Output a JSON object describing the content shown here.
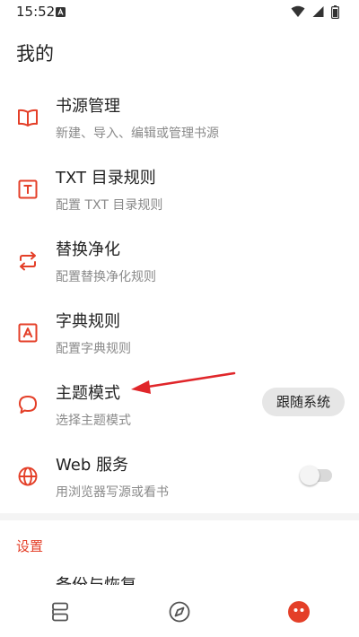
{
  "status_bar": {
    "time": "15:52",
    "icons": [
      "notification-icon",
      "wifi-icon",
      "signal-icon",
      "battery-icon"
    ]
  },
  "page_title": "我的",
  "menu": [
    {
      "title": "书源管理",
      "subtitle": "新建、导入、编辑或管理书源",
      "icon": "book-open-icon"
    },
    {
      "title": "TXT 目录规则",
      "subtitle": "配置 TXT 目录规则",
      "icon": "text-box-icon"
    },
    {
      "title": "替换净化",
      "subtitle": "配置替换净化规则",
      "icon": "swap-arrows-icon"
    },
    {
      "title": "字典规则",
      "subtitle": "配置字典规则",
      "icon": "letter-a-box-icon"
    },
    {
      "title": "主题模式",
      "subtitle": "选择主题模式",
      "icon": "speech-bubble-icon",
      "value": "跟随系统"
    },
    {
      "title": "Web 服务",
      "subtitle": "用浏览器写源或看书",
      "icon": "globe-icon",
      "toggle_on": false
    }
  ],
  "settings_section": {
    "title": "设置",
    "first_item": "备份与恢复"
  },
  "bottom_nav": {
    "items": [
      "bookshelf-icon",
      "compass-icon",
      "my-profile-icon"
    ],
    "active_index": 2
  },
  "colors": {
    "accent": "#e43f28",
    "annotation_arrow": "#e0262a",
    "subtitle_text": "#8a8a8a",
    "chip_background": "#e6e6e6"
  }
}
